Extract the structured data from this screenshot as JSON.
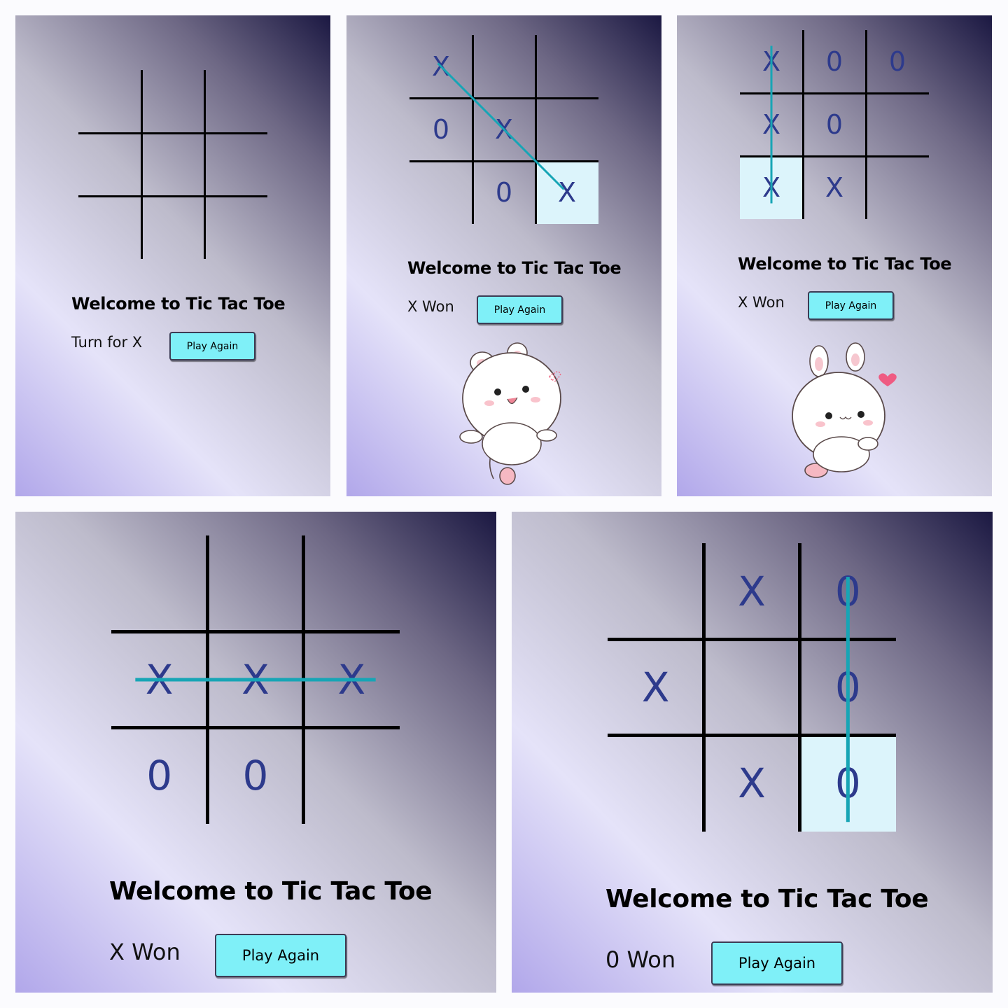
{
  "colors": {
    "accent_button": "#7ff0f8",
    "mark_color": "#2d3a8c",
    "win_line": "#17a5b5",
    "highlight_cell": "#dcf4fb",
    "grid_line": "#000000"
  },
  "panels": [
    {
      "title": "Welcome to Tic Tac Toe",
      "status": "Turn for X",
      "button_label": "Play Again",
      "board": [
        "",
        "",
        "",
        "",
        "",
        "",
        "",
        "",
        ""
      ],
      "highlight_cell": null,
      "win_line": null,
      "mascot": null
    },
    {
      "title": "Welcome to Tic Tac Toe",
      "status": "X Won",
      "button_label": "Play Again",
      "board": [
        "X",
        "",
        "",
        "0",
        "X",
        "",
        "",
        "0",
        "X"
      ],
      "highlight_cell": 8,
      "win_line": "diagonal-main",
      "mascot": "bunny-waving"
    },
    {
      "title": "Welcome to Tic Tac Toe",
      "status": "X Won",
      "button_label": "Play Again",
      "board": [
        "X",
        "0",
        "0",
        "X",
        "0",
        "",
        "X",
        "X",
        ""
      ],
      "highlight_cell": 6,
      "win_line": "column-1",
      "mascot": "bunny-heart"
    },
    {
      "title": "Welcome to Tic Tac Toe",
      "status": "X Won",
      "button_label": "Play Again",
      "board": [
        "",
        "",
        "",
        "X",
        "X",
        "X",
        "0",
        "0",
        ""
      ],
      "highlight_cell": null,
      "win_line": "row-2",
      "mascot": null
    },
    {
      "title": "Welcome to Tic Tac Toe",
      "status": "0 Won",
      "button_label": "Play Again",
      "board": [
        "",
        "X",
        "0",
        "X",
        "",
        "0",
        "",
        "X",
        "0"
      ],
      "highlight_cell": 8,
      "win_line": "column-3",
      "mascot": null
    }
  ]
}
